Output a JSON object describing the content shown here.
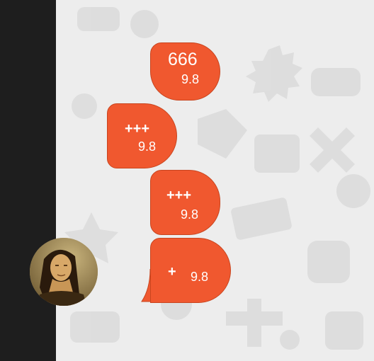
{
  "colors": {
    "bubble": "#f0582f",
    "bubble_border": "#c8451f",
    "rail": "#1e1e1e",
    "background": "#ededed"
  },
  "messages": [
    {
      "text": "666",
      "time": "9.8"
    },
    {
      "text": "+++",
      "time": "9.8"
    },
    {
      "text": "+++",
      "time": "9.8"
    },
    {
      "text": "+",
      "time": "9.8"
    }
  ],
  "avatar": {
    "icon": "mona-lisa-portrait"
  }
}
